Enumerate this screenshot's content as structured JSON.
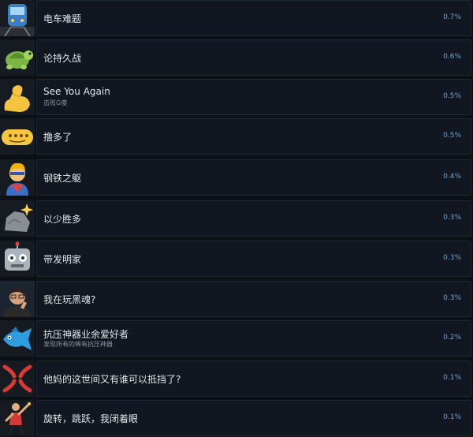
{
  "achievements": [
    {
      "title": "电车难题",
      "desc": "",
      "percent": "0.7%",
      "icon": "train-icon"
    },
    {
      "title": "论持久战",
      "desc": "",
      "percent": "0.6%",
      "icon": "turtle-icon"
    },
    {
      "title": "See You Again",
      "desc": "击败G傻",
      "percent": "0.5%",
      "icon": "flexed-bicep-icon"
    },
    {
      "title": "撸多了",
      "desc": "",
      "percent": "0.5%",
      "icon": "sausage-face-icon"
    },
    {
      "title": "钢铁之躯",
      "desc": "",
      "percent": "0.4%",
      "icon": "superhero-icon"
    },
    {
      "title": "以少胜多",
      "desc": "",
      "percent": "0.3%",
      "icon": "rock-sparkle-icon"
    },
    {
      "title": "带发明家",
      "desc": "",
      "percent": "0.3%",
      "icon": "robot-icon"
    },
    {
      "title": "我在玩黑魂?",
      "desc": "",
      "percent": "0.3%",
      "icon": "thinking-man-icon"
    },
    {
      "title": "抗压神器业余爱好者",
      "desc": "发现所有的稀有抗压神器",
      "percent": "0.2%",
      "icon": "fish-icon"
    },
    {
      "title": "他妈的这世间又有谁可以抵挡了?",
      "desc": "",
      "percent": "0.1%",
      "icon": "anger-symbol-icon"
    },
    {
      "title": "旋转，跳跃，我闭着眼",
      "desc": "",
      "percent": "0.1%",
      "icon": "dancer-icon"
    }
  ]
}
